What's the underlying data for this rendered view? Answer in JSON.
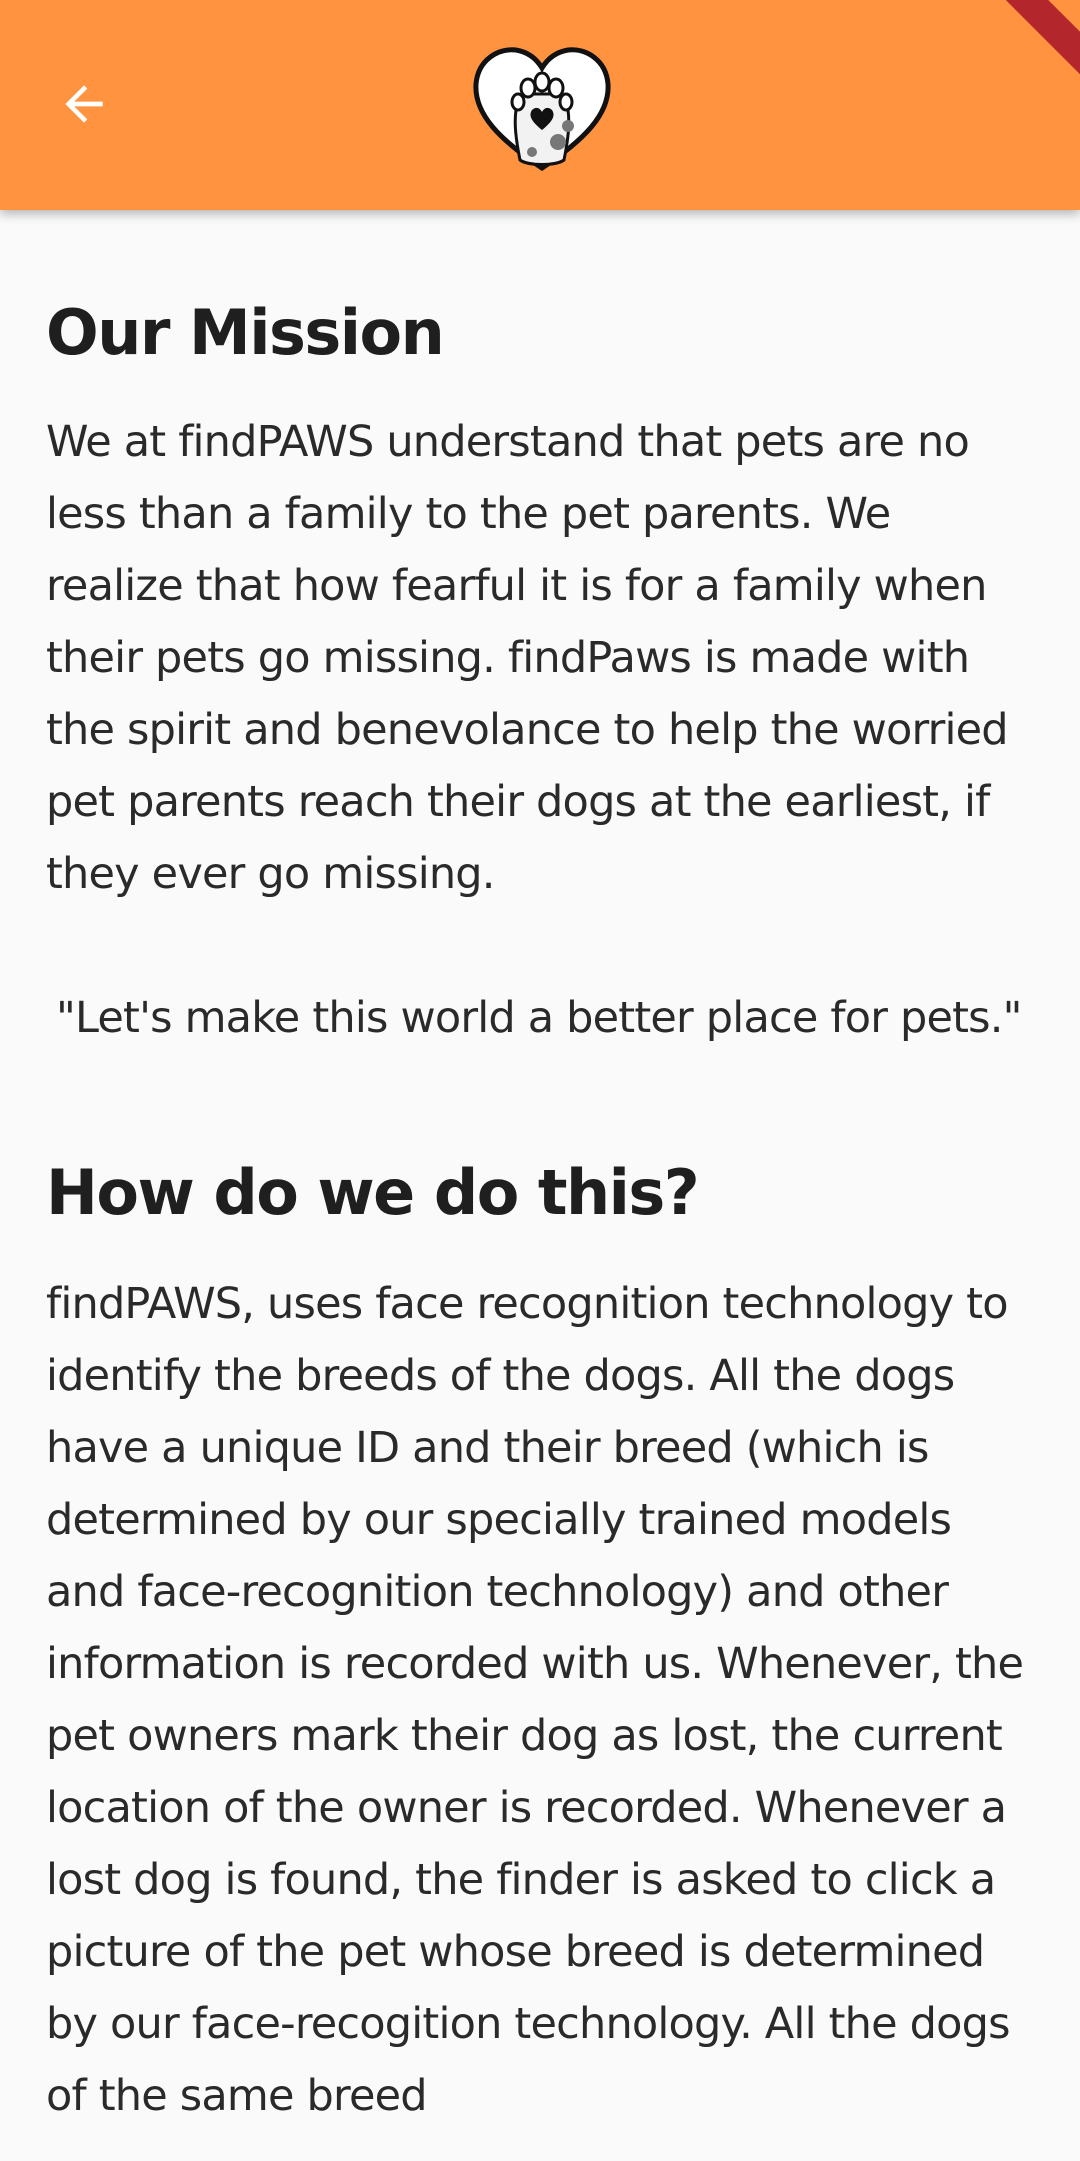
{
  "app_bar": {
    "background_color": "#ff9340",
    "back_icon": "arrow-left-icon",
    "logo_icon": "heart-paw-logo-icon"
  },
  "sections": {
    "mission": {
      "title": "Our Mission",
      "body": "We at findPAWS understand that pets are no less than a family to the pet parents. We realize that how fearful it is for a family when their pets go missing. findPaws is made with the spirit and benevolance to help the worried pet parents reach their dogs at the earliest, if they ever go missing.",
      "quote": "\"Let's make this world a better place for pets.\""
    },
    "how": {
      "title": "How do we do this?",
      "body": "findPAWS, uses face recognition technology to identify the breeds of the dogs. All the dogs have a unique ID and their breed (which is determined by our specially trained models and face-recognition technology) and other information is recorded with us. Whenever, the pet owners mark their dog as lost, the current location of the owner is recorded. Whenever a lost dog is found, the finder is asked to click a picture of the pet whose breed is determined by our face-recogition technology. All the dogs of the same breed"
    }
  }
}
